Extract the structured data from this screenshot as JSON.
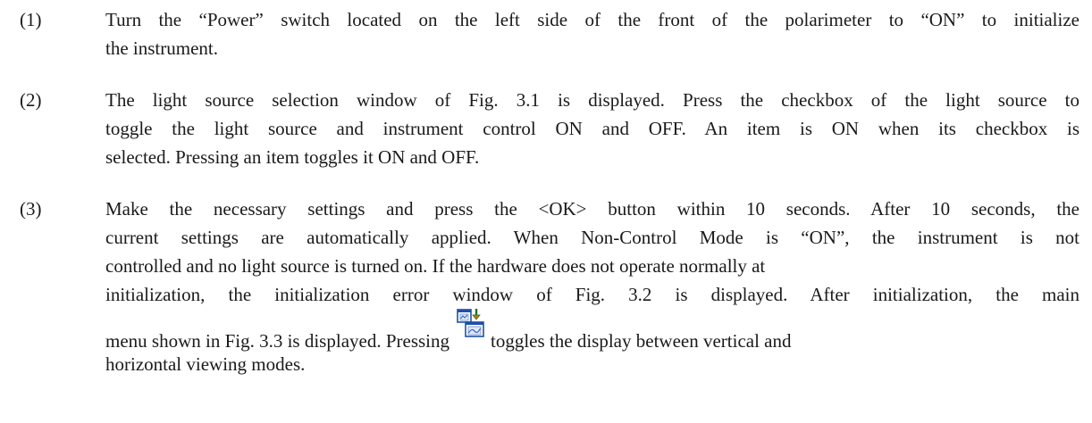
{
  "steps": [
    {
      "num": "(1)",
      "lines": [
        "Turn the “Power” switch located on the left side of the front of the polarimeter to “ON” to initialize",
        "the instrument."
      ]
    },
    {
      "num": "(2)",
      "lines": [
        "The light source selection window of Fig. 3.1 is displayed. Press the checkbox of the light source to",
        "toggle the light source and instrument control ON and OFF. An item is ON when its checkbox is",
        "selected. Pressing an item toggles it ON and OFF."
      ]
    },
    {
      "num": "(3)",
      "lines": [
        "Make the necessary settings and press the <OK> button within 10 seconds. After 10 seconds, the",
        "current settings are automatically applied. When Non-Control Mode is “ON”, the instrument is not",
        "controlled and no light source is turned on. If the hardware does not operate normally at",
        "initialization, the initialization error window of Fig. 3.2 is displayed. After initialization, the main"
      ],
      "icon_line_before": "menu shown in Fig. 3.3 is displayed. Pressing",
      "icon_line_after": "toggles the display between vertical and",
      "last_line": "horizontal viewing modes.",
      "icon_name": "view-toggle-icon"
    }
  ]
}
